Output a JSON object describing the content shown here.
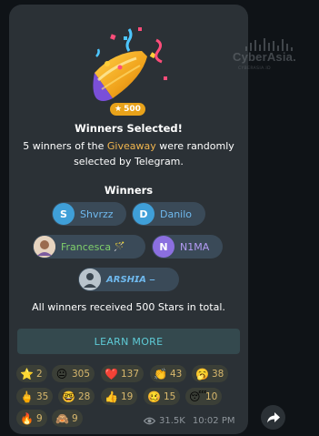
{
  "watermark": {
    "name": "CyberAsia.",
    "sub": "CYBERASIA.ID"
  },
  "badge": {
    "icon": "star-icon",
    "value": "500"
  },
  "title": "Winners Selected!",
  "description": {
    "before": "5 winners of the ",
    "highlight": "Giveaway",
    "after": " were randomly selected by Telegram."
  },
  "winners_heading": "Winners",
  "winners": [
    {
      "initial": "S",
      "name": "Shvrzz",
      "avatar_color": "#3f9fd8",
      "name_color": "#6fb9ee"
    },
    {
      "initial": "D",
      "name": "Danilo",
      "avatar_color": "#3f9fd8",
      "name_color": "#6fb9ee"
    },
    {
      "initial": "",
      "name": "Francesca",
      "avatar_color": "#c9a98a",
      "name_color": "#7fcf6b",
      "suffix_emoji": "🪄"
    },
    {
      "initial": "N",
      "name": "N1MA",
      "avatar_color": "#8b6fe0",
      "name_color": "#b49cf5"
    },
    {
      "initial": "",
      "name": "𝘼𝙍𝙎𝙃𝙄𝘼 ⎯",
      "avatar_color": "#8fa1b0",
      "name_color": "#6fb9ee"
    }
  ],
  "summary": "All winners received 500 Stars in total.",
  "learn_more": "LEARN MORE",
  "reactions": [
    {
      "emoji": "⭐",
      "icon": "star-icon",
      "count": "2"
    },
    {
      "emoji": "😐",
      "icon": "neutral-face-icon",
      "count": "305"
    },
    {
      "emoji": "❤️",
      "icon": "heart-icon",
      "count": "137"
    },
    {
      "emoji": "👏",
      "icon": "clap-icon",
      "count": "43"
    },
    {
      "emoji": "🥱",
      "icon": "yawn-icon",
      "count": "38"
    },
    {
      "emoji": "🖕",
      "icon": "hand-icon",
      "count": "35"
    },
    {
      "emoji": "🤓",
      "icon": "nerd-icon",
      "count": "28"
    },
    {
      "emoji": "👍",
      "icon": "thumbs-up-icon",
      "count": "19"
    },
    {
      "emoji": "🥴",
      "icon": "woozy-face-icon",
      "count": "15"
    },
    {
      "emoji": "😴",
      "icon": "sleeping-face-icon",
      "count": "10"
    },
    {
      "emoji": "🔥",
      "icon": "fire-icon",
      "count": "9"
    },
    {
      "emoji": "🙈",
      "icon": "monkey-icon",
      "count": "9"
    }
  ],
  "views": "31.5K",
  "time": "10:02 PM",
  "colors": {
    "bubble": "#2b3136",
    "accent_gold": "#f0b54e",
    "link": "#5ecbd6",
    "badge": "#e8a21a"
  }
}
